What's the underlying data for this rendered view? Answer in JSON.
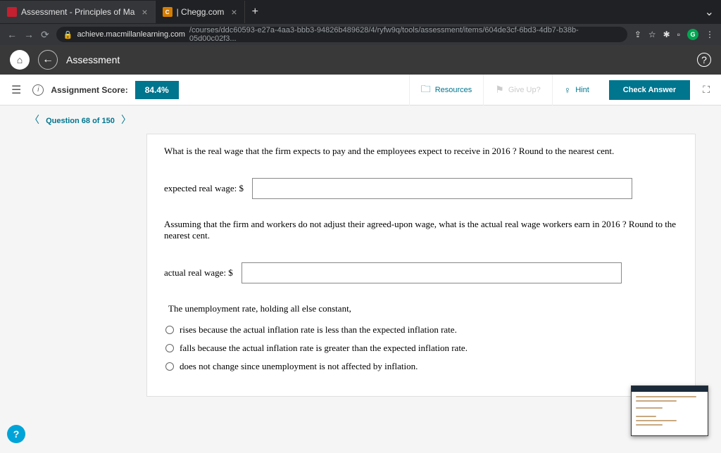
{
  "browser": {
    "tabs": [
      {
        "favicon": "red",
        "label": "Assessment - Principles of Ma"
      },
      {
        "favicon": "orange",
        "label": "| Chegg.com"
      }
    ],
    "url_host": "achieve.macmillanlearning.com",
    "url_path": "/courses/ddc60593-e27a-4aa3-bbb3-94826b489628/4/ryfw9q/tools/assessment/items/604de3cf-6bd3-4db7-b38b-05d00c02f3...",
    "ext_letter": "G"
  },
  "app": {
    "title": "Assessment"
  },
  "scorebar": {
    "label": "Assignment Score:",
    "value": "84.4%",
    "resources": "Resources",
    "giveup": "Give Up?",
    "hint": "Hint",
    "check": "Check Answer"
  },
  "questionNav": {
    "label": "Question 68 of 150"
  },
  "question": {
    "prompt1": "What is the real wage that the firm expects to pay and the employees expect to receive in 2016 ? Round to the nearest cent.",
    "input1_label": "expected real wage: $",
    "input1_value": "",
    "prompt2": "Assuming that the firm and workers do not adjust their agreed-upon wage, what is the actual real wage workers earn in 2016 ? Round to the nearest cent.",
    "input2_label": "actual real wage: $",
    "input2_value": "",
    "prompt3": "The unemployment rate, holding all else constant,",
    "options": [
      "rises because the actual inflation rate is less than the expected inflation rate.",
      "falls because the actual inflation rate is greater than the expected inflation rate.",
      "does not change since unemployment is not affected by inflation."
    ]
  }
}
